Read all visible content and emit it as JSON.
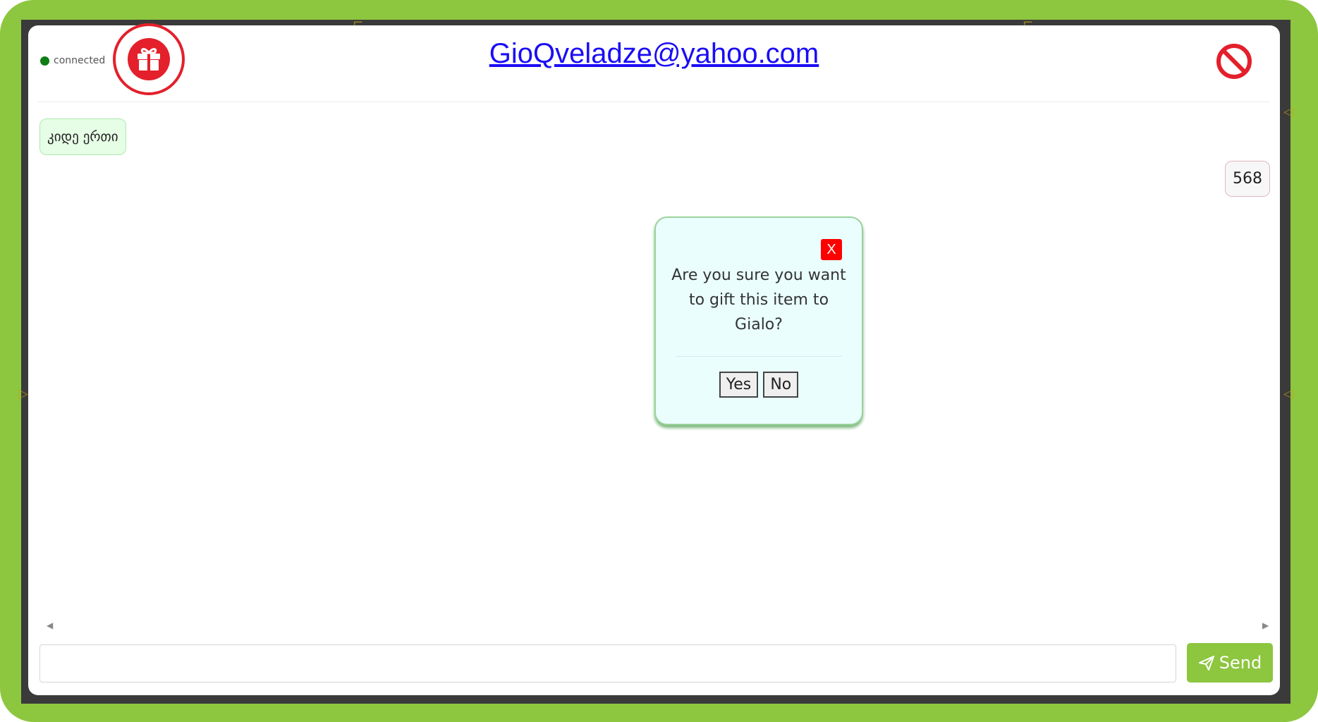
{
  "app": {
    "status_label": "connected",
    "recipient_title": "GioQveladze@yahoo.com"
  },
  "icons": {
    "gift": "gift-icon",
    "block": "block-icon",
    "send": "paper-plane-icon"
  },
  "colors": {
    "brand": "#8dc63f",
    "connected": "#0d7d14",
    "danger": "#e3202b",
    "link": "#1a0df5"
  },
  "messages": [
    {
      "direction": "incoming",
      "text": "კიდე ერთი"
    },
    {
      "direction": "outgoing",
      "text": "568"
    }
  ],
  "modal": {
    "close_label": "X",
    "text": "Are you sure you want to gift this item to Gialo?",
    "yes_label": "Yes",
    "no_label": "No"
  },
  "composer": {
    "placeholder": "",
    "value": "",
    "send_label": "Send"
  }
}
